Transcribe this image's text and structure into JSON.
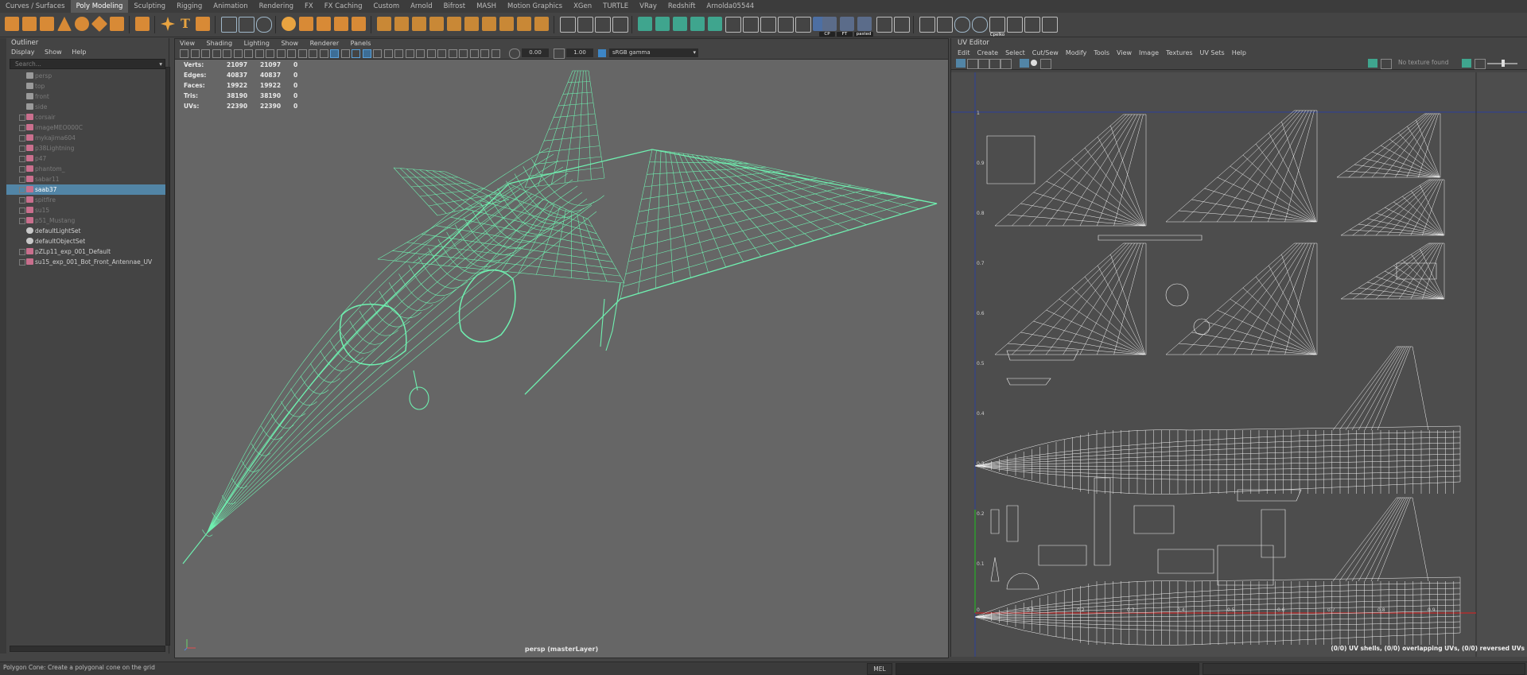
{
  "shelf_tabs": [
    "Curves / Surfaces",
    "Poly Modeling",
    "Sculpting",
    "Rigging",
    "Animation",
    "Rendering",
    "FX",
    "FX Caching",
    "Custom",
    "Arnold",
    "Bifrost",
    "MASH",
    "Motion Graphics",
    "XGen",
    "TURTLE",
    "VRay",
    "Redshift",
    "Arnolda05544"
  ],
  "shelf_active_index": 1,
  "shelf_icon_labels": {
    "cp": "CP",
    "ft": "FT",
    "pasted": "pasted",
    "cpelko": "Cpelko"
  },
  "outliner": {
    "title": "Outliner",
    "menu": [
      "Display",
      "Show",
      "Help"
    ],
    "search_placeholder": "Search...",
    "items": [
      {
        "label": "persp",
        "dim": true,
        "type": "camera"
      },
      {
        "label": "top",
        "dim": true,
        "type": "camera"
      },
      {
        "label": "front",
        "dim": true,
        "type": "camera"
      },
      {
        "label": "side",
        "dim": true,
        "type": "camera"
      },
      {
        "label": "corsair",
        "dim": true,
        "type": "mesh"
      },
      {
        "label": "imageMEO000C",
        "dim": true,
        "type": "mesh"
      },
      {
        "label": "mykajima604",
        "dim": true,
        "type": "mesh"
      },
      {
        "label": "p38Lightning",
        "dim": true,
        "type": "mesh"
      },
      {
        "label": "p47",
        "dim": true,
        "type": "mesh"
      },
      {
        "label": "phantom_",
        "dim": true,
        "type": "mesh"
      },
      {
        "label": "sabar11",
        "dim": true,
        "type": "mesh"
      },
      {
        "label": "saab37",
        "dim": false,
        "type": "mesh",
        "selected": true
      },
      {
        "label": "spitfire",
        "dim": true,
        "type": "mesh"
      },
      {
        "label": "su15",
        "dim": true,
        "type": "mesh"
      },
      {
        "label": "p51_Mustang",
        "dim": true,
        "type": "mesh"
      },
      {
        "label": "defaultLightSet",
        "dim": false,
        "type": "set"
      },
      {
        "label": "defaultObjectSet",
        "dim": false,
        "type": "set"
      },
      {
        "label": "pZLp11_exp_001_Default",
        "dim": false,
        "type": "mesh"
      },
      {
        "label": "su15_exp_001_Bot_Front_Antennae_UV",
        "dim": false,
        "type": "mesh"
      }
    ]
  },
  "viewport": {
    "menu": [
      "View",
      "Shading",
      "Lighting",
      "Show",
      "Renderer",
      "Panels"
    ],
    "exposure": "0.00",
    "gamma": "1.00",
    "colorspace": "sRGB gamma",
    "hud": [
      {
        "label": "Verts:",
        "a": "21097",
        "b": "21097",
        "c": "0"
      },
      {
        "label": "Edges:",
        "a": "40837",
        "b": "40837",
        "c": "0"
      },
      {
        "label": "Faces:",
        "a": "19922",
        "b": "19922",
        "c": "0"
      },
      {
        "label": "Tris:",
        "a": "38190",
        "b": "38190",
        "c": "0"
      },
      {
        "label": "UVs:",
        "a": "22390",
        "b": "22390",
        "c": "0"
      }
    ],
    "camera_label": "persp (masterLayer)",
    "wire_color": "#6ff0b0"
  },
  "uv_editor": {
    "title": "UV Editor",
    "menu": [
      "Edit",
      "Create",
      "Select",
      "Cut/Sew",
      "Modify",
      "Tools",
      "View",
      "Image",
      "Textures",
      "UV Sets",
      "Help"
    ],
    "texture_status": "No texture found",
    "status": "(0/0) UV shells, (0/0) overlapping UVs, (0/0) reversed UVs",
    "v_ticks": [
      "1",
      "0.9",
      "0.8",
      "0.7",
      "0.6",
      "0.5",
      "0.4",
      "0.3",
      "0.2",
      "0.1"
    ],
    "u_ticks": [
      "0",
      "0.1",
      "0.2",
      "0.3",
      "0.4",
      "0.5",
      "0.6",
      "0.7",
      "0.8",
      "0.9"
    ]
  },
  "statusbar": {
    "help": "Polygon Cone: Create a polygonal cone on the grid",
    "mel_label": "MEL"
  }
}
